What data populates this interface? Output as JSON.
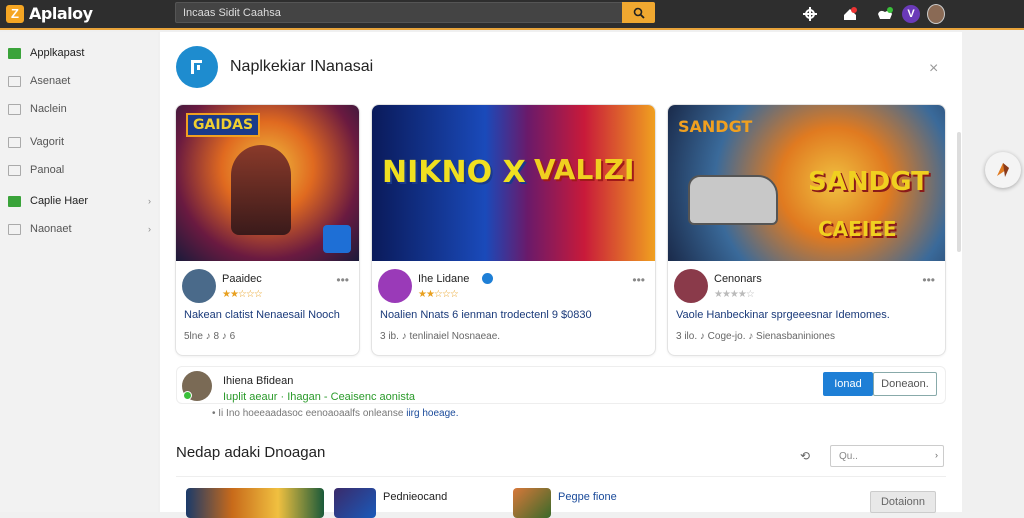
{
  "app": {
    "logo_glyph": "Z",
    "name": "Aplaloy",
    "brand_color": "#f5a623"
  },
  "search": {
    "value": "Incaas Sidit  Caahsa"
  },
  "topbar_icons": [
    "settings-icon",
    "notifications-icon",
    "controller-icon",
    "profile-badge-icon",
    "user-avatar"
  ],
  "sidebar": {
    "items": [
      {
        "label": "Applkapast",
        "icon": "apps-icon",
        "active": true
      },
      {
        "label": "Asenaet",
        "icon": "grid-icon"
      },
      {
        "label": "Naclein",
        "icon": "list-icon"
      },
      {
        "label": "Vagorit",
        "icon": "chart-icon"
      },
      {
        "label": "Panoal",
        "icon": "panel-icon"
      },
      {
        "label": "Caplie Haer",
        "icon": "folder-icon",
        "active": true,
        "chevron": "›"
      },
      {
        "label": "Naonaet",
        "icon": "box-icon",
        "chevron": "›"
      }
    ]
  },
  "modal": {
    "title": "Naplkekiar INanasai",
    "close": "×",
    "cards": [
      {
        "name": "Paaidec",
        "stars": "★★☆☆☆",
        "dots": "•••",
        "desc": "Nakean clatist Nenaesail Nooch",
        "meta": "5lne  ♪  8 ♪ 6",
        "img_text": "GAIDAS",
        "avatar": "#4a6a8a"
      },
      {
        "name": "Ihe Lidane",
        "stars": "★★☆☆☆",
        "dots": "•••",
        "desc": "Noalien Nnats 6 ienman trodectenl 9 $0830",
        "meta": "3 ib.  ♪  tenlinaiel Nosnaeae.",
        "img_text": "NIKNO X",
        "img_text2": "VALIZI",
        "avatar": "#9a3ab8",
        "verified": true
      },
      {
        "name": "Cenonars",
        "stars": "★★★★☆",
        "dots": "•••",
        "desc": "Vaole Hanbeckinar sprgeeesnar Idemomes.",
        "meta": "3 ilo.  ♪  Coge-jo.  ♪  Sienasbaniniones",
        "img_text": "SANDGT",
        "img_text2": "CAEIEE",
        "avatar": "#8a3a4a"
      }
    ]
  },
  "user_row": {
    "name": "Ihiena Bfidean",
    "sub": "Iuplit aeaur · Ihagan - Ceaisenc aonista",
    "primary_btn": "Ionad",
    "secondary_btn": "Doneaon."
  },
  "stray": {
    "text": "• Ii Ino  hoeeaadasoc eenoaoaalfs onleanse ",
    "link": "iirg hoeage."
  },
  "section": {
    "title": "Nedap adaki Dnoagan",
    "filter_icon": "⟲",
    "filter_value": "Qu..",
    "filter_arrow": "›"
  },
  "list": [
    {
      "title": "",
      "thumb": "#c86a1a"
    },
    {
      "title": "Pednieocand",
      "thumb": "#3a2a6a"
    },
    {
      "title": "Pegpe fione",
      "thumb": "#d8783a"
    }
  ],
  "list_btn": "Dotaionn"
}
